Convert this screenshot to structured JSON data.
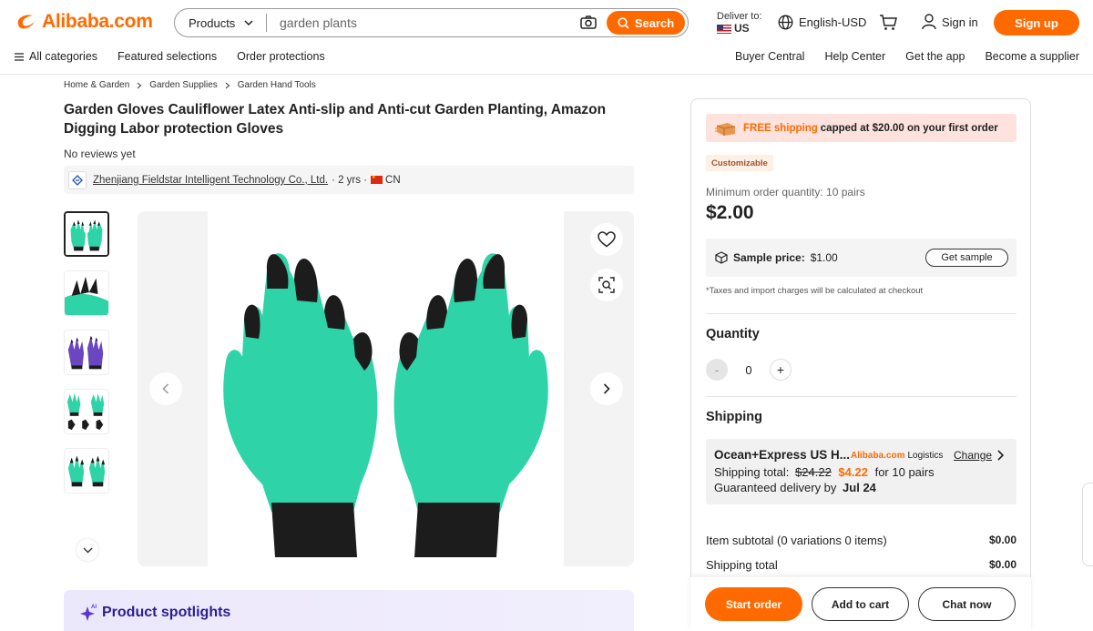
{
  "header": {
    "logo_text": "Alibaba.com",
    "products_label": "Products",
    "search_value": "garden plants",
    "search_button": "Search",
    "deliver_label": "Deliver to:",
    "deliver_country": "US",
    "language": "English-USD",
    "signin_label": "Sign in",
    "signup_label": "Sign up"
  },
  "nav": {
    "left": [
      "All categories",
      "Featured selections",
      "Order protections"
    ],
    "right": [
      "Buyer Central",
      "Help Center",
      "Get the app",
      "Become a supplier"
    ]
  },
  "breadcrumb": [
    "Home & Garden",
    "Garden Supplies",
    "Garden Hand Tools"
  ],
  "product": {
    "title": "Garden Gloves Cauliflower Latex Anti-slip and Anti-cut Garden Planting, Amazon Digging Labor protection Gloves",
    "reviews": "No reviews yet",
    "supplier_name": "Zhenjiang Fieldstar Intelligent Technology Co., Ltd.",
    "supplier_years": "· 2 yrs ·",
    "supplier_country": "CN"
  },
  "spotlight": {
    "ai_badge": "AI",
    "label": "Product spotlights"
  },
  "panel": {
    "banner_free": "FREE shipping",
    "banner_rest": "capped at $20.00 on your first order",
    "customizable": "Customizable",
    "moq": "Minimum order quantity: 10 pairs",
    "price": "$2.00",
    "sample_label": "Sample price:",
    "sample_value": "$1.00",
    "sample_button": "Get sample",
    "tax_note": "*Taxes and import charges will be calculated at checkout",
    "quantity_title": "Quantity",
    "quantity_minus": "-",
    "quantity_value": "0",
    "quantity_plus": "+",
    "shipping_title": "Shipping",
    "shipping_method": "Ocean+Express US H...",
    "logistics_brand": "Alibaba.com",
    "logistics_word": "Logistics",
    "change_label": "Change",
    "shipping_total_label": "Shipping total:",
    "shipping_total_old": "$24.22",
    "shipping_total_new": "$4.22",
    "shipping_total_for": "for 10 pairs",
    "guarantee_label": "Guaranteed delivery by",
    "guarantee_date": "Jul 24",
    "item_subtotal_label": "Item subtotal (0 variations 0 items)",
    "item_subtotal_value": "$0.00",
    "shipping_total_row_label": "Shipping total",
    "shipping_total_row_value": "$0.00"
  },
  "actions": {
    "start_order": "Start order",
    "add_to_cart": "Add to cart",
    "chat_now": "Chat now"
  },
  "colors": {
    "accent": "#ff6a00",
    "glove_green": "#2fd3a8",
    "glove_black": "#1c1c1c"
  }
}
